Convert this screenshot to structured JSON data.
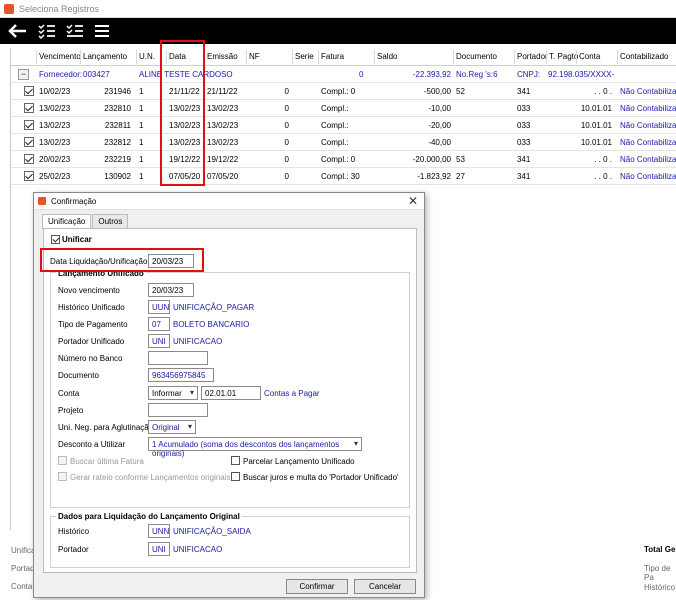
{
  "window": {
    "title": "Seleciona Registros"
  },
  "toolbar": {
    "icons": [
      "back-arrow-icon",
      "checklist-icon",
      "checklist-alt-icon",
      "menu-icon"
    ]
  },
  "grid": {
    "columns": [
      "Vencimento",
      "Lançamento",
      "U.N.",
      "Data",
      "Emissão",
      "NF",
      "Serie",
      "Fatura",
      "Saldo",
      "Documento",
      "Portador",
      "T. Pagto",
      "Conta",
      "Contabilizado"
    ],
    "supplier_row": {
      "label": "Fornecedor:",
      "code": "003427",
      "name": "ALINE TESTE CARDOSO",
      "fatura": "0",
      "saldo": "-22.393,92",
      "documento": "No.Reg 's:6",
      "portador": "CNPJ:",
      "cnpj": "92.198.035/XXXX-"
    },
    "rows": [
      {
        "venc": "10/02/23",
        "lanc": "231946",
        "un": "1",
        "data": "21/11/22",
        "emissao": "21/11/22",
        "nf": "0",
        "fatura": "Compl.: 0",
        "saldo": "-500,00",
        "doc": "52",
        "portador": "341",
        "conta": ". . 0 .",
        "contab": "Não Contabilizar"
      },
      {
        "venc": "13/02/23",
        "lanc": "232810",
        "un": "1",
        "data": "13/02/23",
        "emissao": "13/02/23",
        "nf": "0",
        "fatura": "Compl.:",
        "saldo": "-10,00",
        "doc": "",
        "portador": "033",
        "conta": "10.01.01",
        "contab": "Não Contabilizar"
      },
      {
        "venc": "13/02/23",
        "lanc": "232811",
        "un": "1",
        "data": "13/02/23",
        "emissao": "13/02/23",
        "nf": "0",
        "fatura": "Compl.:",
        "saldo": "-20,00",
        "doc": "",
        "portador": "033",
        "conta": "10.01.01",
        "contab": "Não Contabilizar"
      },
      {
        "venc": "13/02/23",
        "lanc": "232812",
        "un": "1",
        "data": "13/02/23",
        "emissao": "13/02/23",
        "nf": "0",
        "fatura": "Compl.:",
        "saldo": "-40,00",
        "doc": "",
        "portador": "033",
        "conta": "10.01.01",
        "contab": "Não Contabilizar"
      },
      {
        "venc": "20/02/23",
        "lanc": "232219",
        "un": "1",
        "data": "19/12/22",
        "emissao": "19/12/22",
        "nf": "0",
        "fatura": "Compl.: 0",
        "saldo": "-20.000,00",
        "doc": "53",
        "portador": "341",
        "conta": ". . 0 .",
        "contab": "Não Contabilizar"
      },
      {
        "venc": "25/02/23",
        "lanc": "130902",
        "un": "1",
        "data": "07/05/20",
        "emissao": "07/05/20",
        "nf": "0",
        "fatura": "Compl.: 30",
        "saldo": "-1.823,92",
        "doc": "27",
        "portador": "341",
        "conta": ". . 0 .",
        "contab": "Não Contabilizar"
      }
    ]
  },
  "bottom": {
    "labels": [
      "Unifica",
      "Portad",
      "Conta"
    ],
    "right_title": "Total Ge",
    "right_labels": [
      "Tipo de Pa",
      "Histórico"
    ]
  },
  "dialog": {
    "title": "Confirmação",
    "tabs": [
      "Unificação",
      "Outros"
    ],
    "unificar_label": "Unificar",
    "data_liq_label": "Data Liquidação/Unificação",
    "data_liq_value": "20/03/23",
    "group_title": "Lançamento Unificado",
    "novo_venc_label": "Novo vencimento",
    "novo_venc_value": "20/03/23",
    "historico_label": "Histórico Unificado",
    "historico_code": "UUN",
    "historico_desc": "UNIFICAÇÃO_PAGAR",
    "tipo_pag_label": "Tipo de Pagamento",
    "tipo_pag_code": "07",
    "tipo_pag_desc": "BOLETO BANCARIO",
    "portador_label": "Portador Unificado",
    "portador_code": "UNI",
    "portador_desc": "UNIFICACAO",
    "num_banco_label": "Número no Banco",
    "num_banco_value": "",
    "documento_label": "Documento",
    "documento_value": "963456975845",
    "conta_label": "Conta",
    "conta_select": "Informar",
    "conta_value": "02.01.01",
    "conta_desc": "Contas a Pagar",
    "projeto_label": "Projeto",
    "projeto_value": "",
    "uni_neg_label": "Uni. Neg. para Aglutinação",
    "uni_neg_value": "Original",
    "desconto_label": "Desconto a Utilizar",
    "desconto_value": "1 Acumulado (soma dos descontos dos lançamentos originais)",
    "buscar_fatura_label": "Buscar última Fatura",
    "gerar_rateio_label": "Gerar rateio conforme Lançamentos originais",
    "parcelar_label": "Parcelar Lançamento Unificado",
    "buscar_juros_label": "Buscar juros e multa do 'Portador Unificado'",
    "dados_title": "Dados para Liquidação do Lançamento Original",
    "dados_hist_label": "Histórico",
    "dados_hist_code": "UNN",
    "dados_hist_desc": "UNIFICAÇÃO_SAIDA",
    "dados_port_label": "Portador",
    "dados_port_code": "UNI",
    "dados_port_desc": "UNIFICACAO",
    "confirm_label": "Confirmar",
    "cancel_label": "Cancelar"
  },
  "colors": {
    "link": "#1a1aa6",
    "highlight": "#e01010",
    "toolbar": "#000000"
  }
}
